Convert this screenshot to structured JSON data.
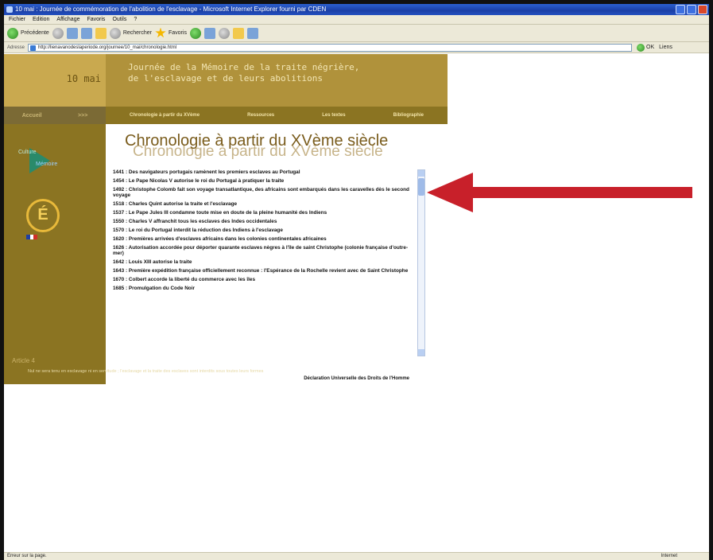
{
  "window": {
    "title": "10 mai : Journée de commémoration de l'abolition de l'esclavage - Microsoft Internet Explorer fourni par CDEN"
  },
  "menu": [
    "Fichier",
    "Edition",
    "Affichage",
    "Favoris",
    "Outils",
    "?"
  ],
  "toolbar": {
    "back_label": "Précédente",
    "search_label": "Rechercher",
    "favorites_label": "Favoris"
  },
  "address": {
    "label": "Adresse",
    "url": "http://lienavanodeslaperiode.org/journee/10_mai/chronologie.html",
    "go_label": "OK",
    "links_label": "Liens"
  },
  "site": {
    "date_label": "10 mai",
    "banner_line1": "Journée de la Mémoire de la traite négrière,",
    "banner_line2": "de l'esclavage et de leurs abolitions",
    "home_label": "Accueil",
    "home_arrow": ">>>",
    "nav": [
      "Chronologie à partir du XVème",
      "Ressources",
      "Les textes",
      "Bibliographie"
    ],
    "logo1_line1": "Culture",
    "logo1_line2": "Mémoire",
    "logo2_glyph": "É",
    "article_label": "Article 4",
    "heading": "Chronologie à partir du XVème siècle",
    "caption_quote": "Nul ne sera tenu en esclavage ni en servitude ; l'esclavage et la traite des esclaves sont interdits sous toutes leurs formes",
    "caption_source": "Déclaration Universelle des Droits de l'Homme"
  },
  "chronology": [
    "1441 : Des navigateurs portugais ramènent les premiers esclaves au Portugal",
    "1454 : Le Pape Nicolas V autorise le roi du Portugal à pratiquer la traite",
    "1492 : Christophe Colomb fait son voyage transatlantique, des africains sont embarqués dans les caravelles dès le second voyage",
    "1518 : Charles Quint autorise la traite et l'esclavage",
    "1537 : Le Pape Jules III condamne toute mise en doute de la pleine humanité des Indiens",
    "1550 : Charles V affranchit tous les esclaves des Indes occidentales",
    "1570 : Le roi du Portugal interdit la réduction des Indiens à l'esclavage",
    "1620 : Premières arrivées d'esclaves africains dans les colonies continentales africaines",
    "1626 : Autorisation accordée pour déporter quarante esclaves nègres à l'île de saint Christophe (colonie française d'outre-mer)",
    "1642 : Louis XIII autorise la traite",
    "1643 : Première expédition française officiellement reconnue : l'Espérance de la Rochelle revient avec de Saint Christophe",
    "1670 : Colbert accorde la liberté du commerce avec les îles",
    "1685 : Promulgation du Code Noir"
  ],
  "status": {
    "left": "Erreur sur la page.",
    "zone": "Internet"
  },
  "colors": {
    "sidebar": "#8b7422",
    "banner": "#b0923b",
    "heading": "#7a5c1c",
    "arrow": "#c8202a"
  }
}
